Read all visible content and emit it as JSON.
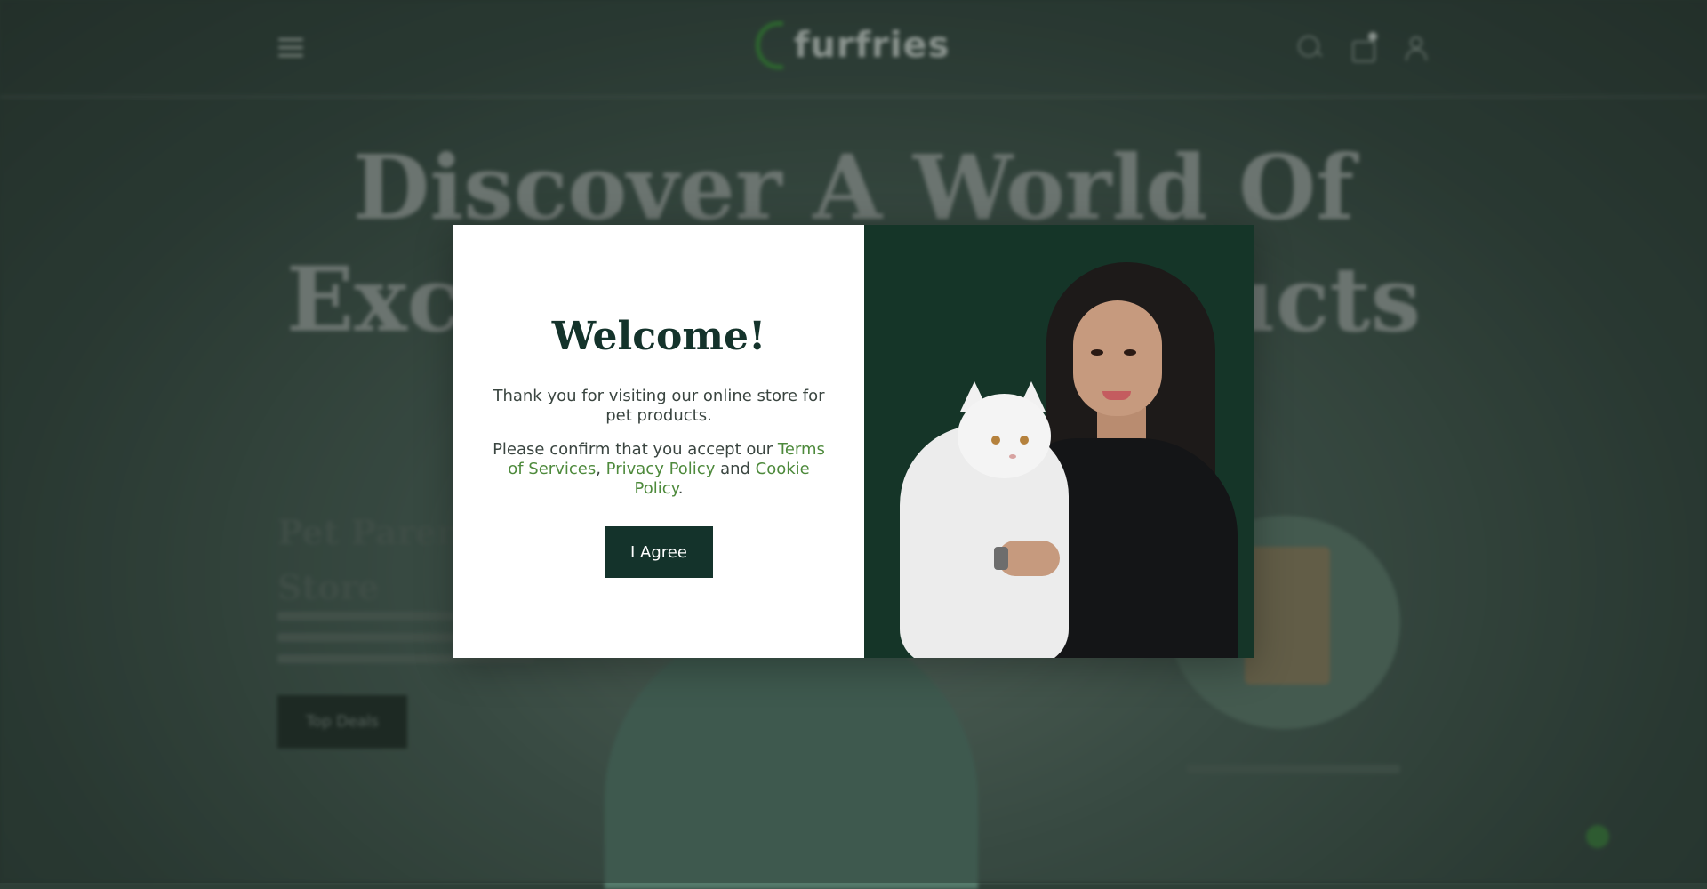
{
  "background": {
    "logo_text": "furfries",
    "hero_line1": "Discover A World Of",
    "hero_line2": "Exclusive Pet Products",
    "sub_title_line1": "Pet Parents",
    "sub_title_line2": "Store",
    "button_label": "Top Deals",
    "icons": [
      "menu-icon",
      "logo-icon",
      "search-icon",
      "cart-icon",
      "user-icon"
    ]
  },
  "modal": {
    "title": "Welcome!",
    "text1": "Thank you for visiting our online store for pet products.",
    "text2_prefix": "Please confirm that you accept our ",
    "terms_link": "Terms of Services",
    "sep1": ", ",
    "privacy_link": "Privacy Policy",
    "sep2": " and ",
    "cookie_link": "Cookie Policy",
    "sep3": ".",
    "agree_label": "I Agree",
    "link_color": "#4e8a3c",
    "accent_color": "#14332b"
  }
}
